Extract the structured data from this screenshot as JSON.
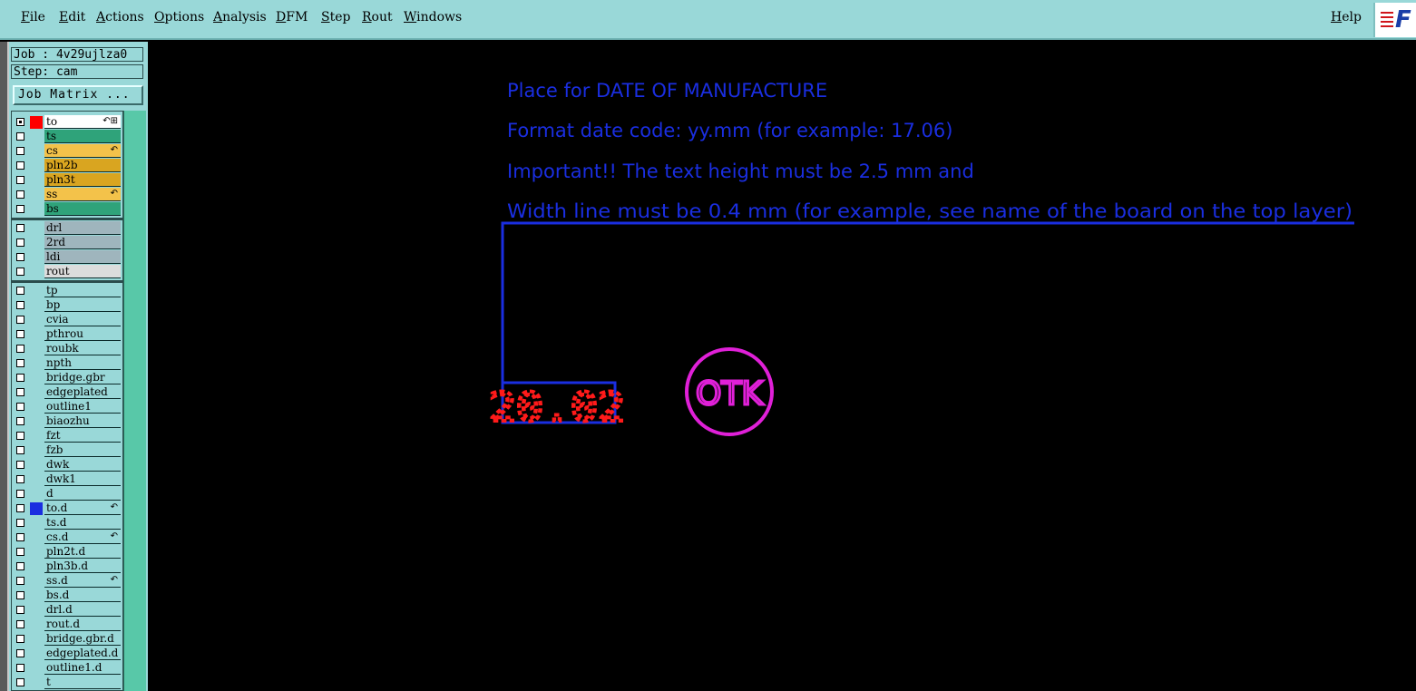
{
  "menu": {
    "items": [
      "File",
      "Edit",
      "Actions",
      "Options",
      "Analysis",
      "DFM",
      "Step",
      "Rout",
      "Windows"
    ],
    "help": "Help",
    "logo_text": "F"
  },
  "panel": {
    "job": "Job : 4v29ujlza0",
    "step": "Step: cam",
    "job_matrix": "Job Matrix ..."
  },
  "layers": [
    {
      "name": "to",
      "color": "#ffffff",
      "swatch": "#ff0000",
      "checked": true,
      "edit": "↶⊞"
    },
    {
      "name": "ts",
      "color": "#2fa37a",
      "swatch": "",
      "checked": false,
      "edit": ""
    },
    {
      "name": "cs",
      "color": "#f3c24a",
      "swatch": "",
      "checked": false,
      "edit": "↶"
    },
    {
      "name": "pln2b",
      "color": "#d9a520",
      "swatch": "",
      "checked": false,
      "edit": ""
    },
    {
      "name": "pln3t",
      "color": "#d9a520",
      "swatch": "",
      "checked": false,
      "edit": ""
    },
    {
      "name": "ss",
      "color": "#f3c24a",
      "swatch": "",
      "checked": false,
      "edit": "↶"
    },
    {
      "name": "bs",
      "color": "#2fa37a",
      "swatch": "",
      "checked": false,
      "edit": ""
    },
    {
      "name": "drl",
      "color": "#9fb5bd",
      "swatch": "",
      "checked": false,
      "edit": ""
    },
    {
      "name": "2rd",
      "color": "#9fb5bd",
      "swatch": "",
      "checked": false,
      "edit": ""
    },
    {
      "name": "ldi",
      "color": "#9fb5bd",
      "swatch": "",
      "checked": false,
      "edit": ""
    },
    {
      "name": "rout",
      "color": "#dcdcdc",
      "swatch": "",
      "checked": false,
      "edit": ""
    },
    {
      "name": "tp",
      "color": "#99d8d8",
      "swatch": "",
      "checked": false,
      "edit": ""
    },
    {
      "name": "bp",
      "color": "#99d8d8",
      "swatch": "",
      "checked": false,
      "edit": ""
    },
    {
      "name": "cvia",
      "color": "#99d8d8",
      "swatch": "",
      "checked": false,
      "edit": ""
    },
    {
      "name": "pthrou",
      "color": "#99d8d8",
      "swatch": "",
      "checked": false,
      "edit": ""
    },
    {
      "name": "roubk",
      "color": "#99d8d8",
      "swatch": "",
      "checked": false,
      "edit": ""
    },
    {
      "name": "npth",
      "color": "#99d8d8",
      "swatch": "",
      "checked": false,
      "edit": ""
    },
    {
      "name": "bridge.gbr",
      "color": "#99d8d8",
      "swatch": "",
      "checked": false,
      "edit": ""
    },
    {
      "name": "edgeplated",
      "color": "#99d8d8",
      "swatch": "",
      "checked": false,
      "edit": ""
    },
    {
      "name": "outline1",
      "color": "#99d8d8",
      "swatch": "",
      "checked": false,
      "edit": ""
    },
    {
      "name": "biaozhu",
      "color": "#99d8d8",
      "swatch": "",
      "checked": false,
      "edit": ""
    },
    {
      "name": "fzt",
      "color": "#99d8d8",
      "swatch": "",
      "checked": false,
      "edit": ""
    },
    {
      "name": "fzb",
      "color": "#99d8d8",
      "swatch": "",
      "checked": false,
      "edit": ""
    },
    {
      "name": "dwk",
      "color": "#99d8d8",
      "swatch": "",
      "checked": false,
      "edit": ""
    },
    {
      "name": "dwk1",
      "color": "#99d8d8",
      "swatch": "",
      "checked": false,
      "edit": ""
    },
    {
      "name": "d",
      "color": "#99d8d8",
      "swatch": "",
      "checked": false,
      "edit": ""
    },
    {
      "name": "to.d",
      "color": "#99d8d8",
      "swatch": "#1a2ee0",
      "checked": false,
      "edit": "↶"
    },
    {
      "name": "ts.d",
      "color": "#99d8d8",
      "swatch": "",
      "checked": false,
      "edit": ""
    },
    {
      "name": "cs.d",
      "color": "#99d8d8",
      "swatch": "",
      "checked": false,
      "edit": "↶"
    },
    {
      "name": "pln2t.d",
      "color": "#99d8d8",
      "swatch": "",
      "checked": false,
      "edit": ""
    },
    {
      "name": "pln3b.d",
      "color": "#99d8d8",
      "swatch": "",
      "checked": false,
      "edit": ""
    },
    {
      "name": "ss.d",
      "color": "#99d8d8",
      "swatch": "",
      "checked": false,
      "edit": "↶"
    },
    {
      "name": "bs.d",
      "color": "#99d8d8",
      "swatch": "",
      "checked": false,
      "edit": ""
    },
    {
      "name": "drl.d",
      "color": "#99d8d8",
      "swatch": "",
      "checked": false,
      "edit": ""
    },
    {
      "name": "rout.d",
      "color": "#99d8d8",
      "swatch": "",
      "checked": false,
      "edit": ""
    },
    {
      "name": "bridge.gbr.d",
      "color": "#99d8d8",
      "swatch": "",
      "checked": false,
      "edit": ""
    },
    {
      "name": "edgeplated.d",
      "color": "#99d8d8",
      "swatch": "",
      "checked": false,
      "edit": ""
    },
    {
      "name": "outline1.d",
      "color": "#99d8d8",
      "swatch": "",
      "checked": false,
      "edit": ""
    },
    {
      "name": "t",
      "color": "#99d8d8",
      "swatch": "",
      "checked": false,
      "edit": ""
    }
  ],
  "canvas": {
    "notes": [
      "Place for DATE OF MANUFACTURE",
      "Format date code: yy.mm (for example: 17.06)",
      "Important!! The text height must be 2.5 mm and",
      "Width line must be 0.4 mm (for example, see name of the board on the top layer)"
    ],
    "date_code": "20.02",
    "stamp": "OTK",
    "colors": {
      "note": "#1a2ee0",
      "date": "#ff1a1a",
      "stamp": "#e020d8",
      "outline": "#1a2ee0"
    }
  }
}
